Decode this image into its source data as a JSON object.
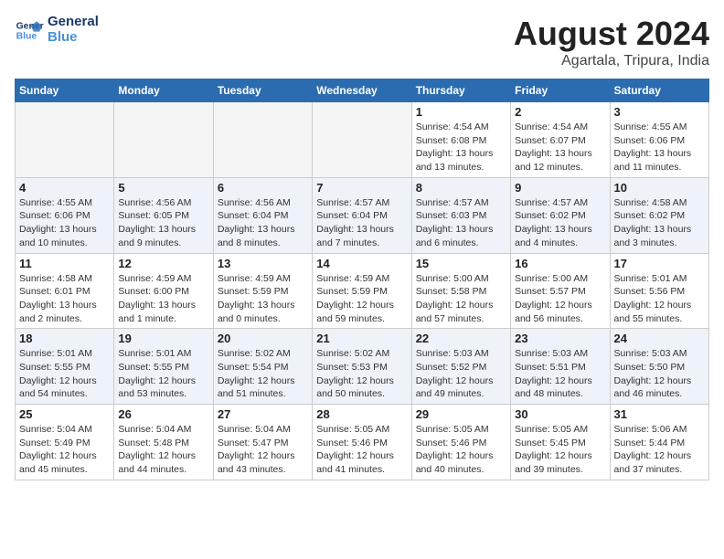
{
  "logo": {
    "line1": "General",
    "line2": "Blue"
  },
  "title": "August 2024",
  "location": "Agartala, Tripura, India",
  "days_of_week": [
    "Sunday",
    "Monday",
    "Tuesday",
    "Wednesday",
    "Thursday",
    "Friday",
    "Saturday"
  ],
  "weeks": [
    [
      {
        "day": "",
        "info": ""
      },
      {
        "day": "",
        "info": ""
      },
      {
        "day": "",
        "info": ""
      },
      {
        "day": "",
        "info": ""
      },
      {
        "day": "1",
        "info": "Sunrise: 4:54 AM\nSunset: 6:08 PM\nDaylight: 13 hours\nand 13 minutes."
      },
      {
        "day": "2",
        "info": "Sunrise: 4:54 AM\nSunset: 6:07 PM\nDaylight: 13 hours\nand 12 minutes."
      },
      {
        "day": "3",
        "info": "Sunrise: 4:55 AM\nSunset: 6:06 PM\nDaylight: 13 hours\nand 11 minutes."
      }
    ],
    [
      {
        "day": "4",
        "info": "Sunrise: 4:55 AM\nSunset: 6:06 PM\nDaylight: 13 hours\nand 10 minutes."
      },
      {
        "day": "5",
        "info": "Sunrise: 4:56 AM\nSunset: 6:05 PM\nDaylight: 13 hours\nand 9 minutes."
      },
      {
        "day": "6",
        "info": "Sunrise: 4:56 AM\nSunset: 6:04 PM\nDaylight: 13 hours\nand 8 minutes."
      },
      {
        "day": "7",
        "info": "Sunrise: 4:57 AM\nSunset: 6:04 PM\nDaylight: 13 hours\nand 7 minutes."
      },
      {
        "day": "8",
        "info": "Sunrise: 4:57 AM\nSunset: 6:03 PM\nDaylight: 13 hours\nand 6 minutes."
      },
      {
        "day": "9",
        "info": "Sunrise: 4:57 AM\nSunset: 6:02 PM\nDaylight: 13 hours\nand 4 minutes."
      },
      {
        "day": "10",
        "info": "Sunrise: 4:58 AM\nSunset: 6:02 PM\nDaylight: 13 hours\nand 3 minutes."
      }
    ],
    [
      {
        "day": "11",
        "info": "Sunrise: 4:58 AM\nSunset: 6:01 PM\nDaylight: 13 hours\nand 2 minutes."
      },
      {
        "day": "12",
        "info": "Sunrise: 4:59 AM\nSunset: 6:00 PM\nDaylight: 13 hours\nand 1 minute."
      },
      {
        "day": "13",
        "info": "Sunrise: 4:59 AM\nSunset: 5:59 PM\nDaylight: 13 hours\nand 0 minutes."
      },
      {
        "day": "14",
        "info": "Sunrise: 4:59 AM\nSunset: 5:59 PM\nDaylight: 12 hours\nand 59 minutes."
      },
      {
        "day": "15",
        "info": "Sunrise: 5:00 AM\nSunset: 5:58 PM\nDaylight: 12 hours\nand 57 minutes."
      },
      {
        "day": "16",
        "info": "Sunrise: 5:00 AM\nSunset: 5:57 PM\nDaylight: 12 hours\nand 56 minutes."
      },
      {
        "day": "17",
        "info": "Sunrise: 5:01 AM\nSunset: 5:56 PM\nDaylight: 12 hours\nand 55 minutes."
      }
    ],
    [
      {
        "day": "18",
        "info": "Sunrise: 5:01 AM\nSunset: 5:55 PM\nDaylight: 12 hours\nand 54 minutes."
      },
      {
        "day": "19",
        "info": "Sunrise: 5:01 AM\nSunset: 5:55 PM\nDaylight: 12 hours\nand 53 minutes."
      },
      {
        "day": "20",
        "info": "Sunrise: 5:02 AM\nSunset: 5:54 PM\nDaylight: 12 hours\nand 51 minutes."
      },
      {
        "day": "21",
        "info": "Sunrise: 5:02 AM\nSunset: 5:53 PM\nDaylight: 12 hours\nand 50 minutes."
      },
      {
        "day": "22",
        "info": "Sunrise: 5:03 AM\nSunset: 5:52 PM\nDaylight: 12 hours\nand 49 minutes."
      },
      {
        "day": "23",
        "info": "Sunrise: 5:03 AM\nSunset: 5:51 PM\nDaylight: 12 hours\nand 48 minutes."
      },
      {
        "day": "24",
        "info": "Sunrise: 5:03 AM\nSunset: 5:50 PM\nDaylight: 12 hours\nand 46 minutes."
      }
    ],
    [
      {
        "day": "25",
        "info": "Sunrise: 5:04 AM\nSunset: 5:49 PM\nDaylight: 12 hours\nand 45 minutes."
      },
      {
        "day": "26",
        "info": "Sunrise: 5:04 AM\nSunset: 5:48 PM\nDaylight: 12 hours\nand 44 minutes."
      },
      {
        "day": "27",
        "info": "Sunrise: 5:04 AM\nSunset: 5:47 PM\nDaylight: 12 hours\nand 43 minutes."
      },
      {
        "day": "28",
        "info": "Sunrise: 5:05 AM\nSunset: 5:46 PM\nDaylight: 12 hours\nand 41 minutes."
      },
      {
        "day": "29",
        "info": "Sunrise: 5:05 AM\nSunset: 5:46 PM\nDaylight: 12 hours\nand 40 minutes."
      },
      {
        "day": "30",
        "info": "Sunrise: 5:05 AM\nSunset: 5:45 PM\nDaylight: 12 hours\nand 39 minutes."
      },
      {
        "day": "31",
        "info": "Sunrise: 5:06 AM\nSunset: 5:44 PM\nDaylight: 12 hours\nand 37 minutes."
      }
    ]
  ]
}
